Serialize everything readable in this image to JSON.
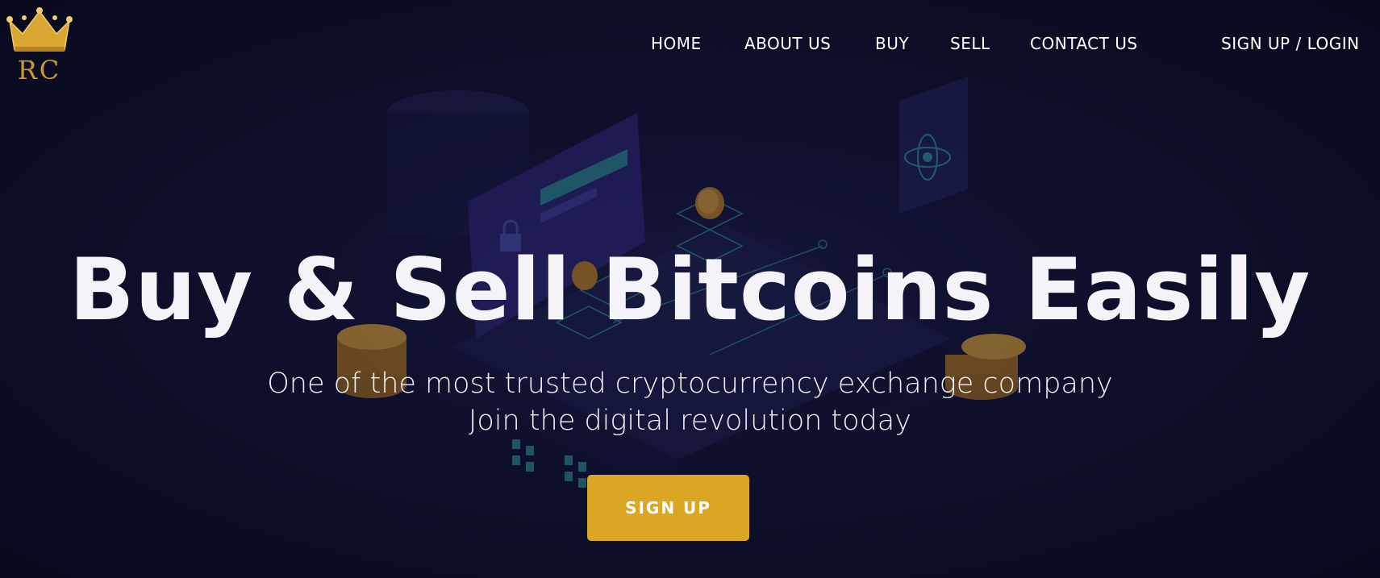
{
  "brand": {
    "logo_text": "RC",
    "colors": {
      "gold": "#dba623",
      "logo_gold": "#c99a2e",
      "background": "#0b0c22",
      "text": "#ffffff"
    }
  },
  "nav": {
    "home": "HOME",
    "about": "ABOUT US",
    "buy": "BUY",
    "sell": "SELL",
    "contact": "CONTACT US",
    "login": "SIGN UP / LOGIN"
  },
  "hero": {
    "title": "Buy & Sell Bitcoins Easily",
    "subtitle_line1": "One of the most trusted cryptocurrency exchange company",
    "subtitle_line2": "Join the digital revolution today",
    "cta_label": "SIGN UP"
  },
  "icons": {
    "logo": "crown-icon",
    "coins": "bitcoin-coin-icon",
    "lock": "padlock-icon",
    "atom": "atom-icon"
  }
}
